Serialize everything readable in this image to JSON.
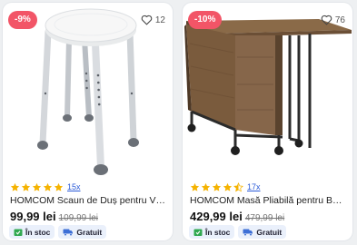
{
  "products": [
    {
      "discount": "-9%",
      "favorites": "12",
      "rating": 5,
      "review_count": "15x",
      "title": "HOMCOM Scaun de Duș pentru Vârs...",
      "price": "99,99 lei",
      "old_price": "109,99 lei",
      "stock_label": "În stoc",
      "delivery_label": "Gratuit",
      "image_icon": "shower-stool"
    },
    {
      "discount": "-10%",
      "favorites": "76",
      "rating": 4.5,
      "review_count": "17x",
      "title": "HOMCOM Masă Pliabilă pentru Bucăt...",
      "price": "429,99 lei",
      "old_price": "479,99 lei",
      "stock_label": "În stoc",
      "delivery_label": "Gratuit",
      "image_icon": "folding-table"
    }
  ],
  "colors": {
    "discount": "#f25567",
    "star": "#f5b301",
    "link": "#2a5ad8",
    "badge_bg": "#eaf0fb",
    "stock_green": "#2fa84f",
    "truck_blue": "#3d6fd6"
  }
}
